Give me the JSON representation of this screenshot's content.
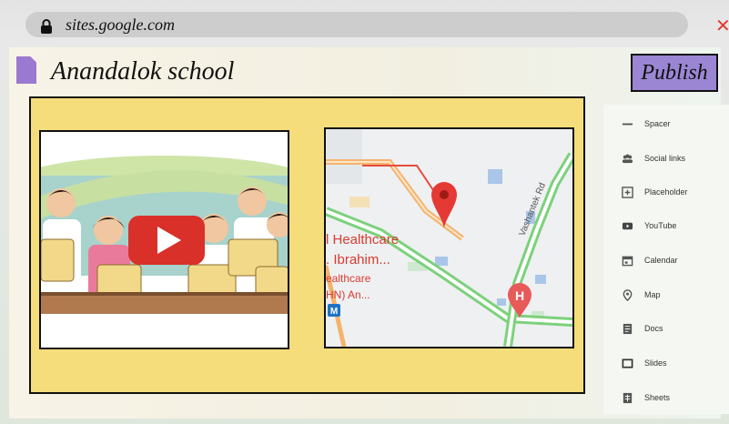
{
  "browser": {
    "url": "sites.google.com",
    "close_icon": "close-icon",
    "lock_icon": "lock-icon"
  },
  "site": {
    "title": "Anandalok school",
    "publish_label": "Publish",
    "publish_color": "#9b86d4"
  },
  "canvas": {
    "background": "#f6dd7c"
  },
  "map": {
    "road_label": "Vashantek Rd",
    "place_lines": [
      "l Healthcare",
      ". Ibrahim...",
      "ealthcare",
      "HN) An..."
    ],
    "hospital_marker": "H",
    "metro_marker": "M"
  },
  "insert_panel": {
    "items": [
      {
        "label": "Spacer",
        "icon": "spacer-icon"
      },
      {
        "label": "Social links",
        "icon": "social-links-icon"
      },
      {
        "label": "Placeholder",
        "icon": "placeholder-icon"
      },
      {
        "label": "YouTube",
        "icon": "youtube-icon"
      },
      {
        "label": "Calendar",
        "icon": "calendar-icon"
      },
      {
        "label": "Map",
        "icon": "map-icon"
      },
      {
        "label": "Docs",
        "icon": "docs-icon"
      },
      {
        "label": "Slides",
        "icon": "slides-icon"
      },
      {
        "label": "Sheets",
        "icon": "sheets-icon"
      }
    ]
  }
}
